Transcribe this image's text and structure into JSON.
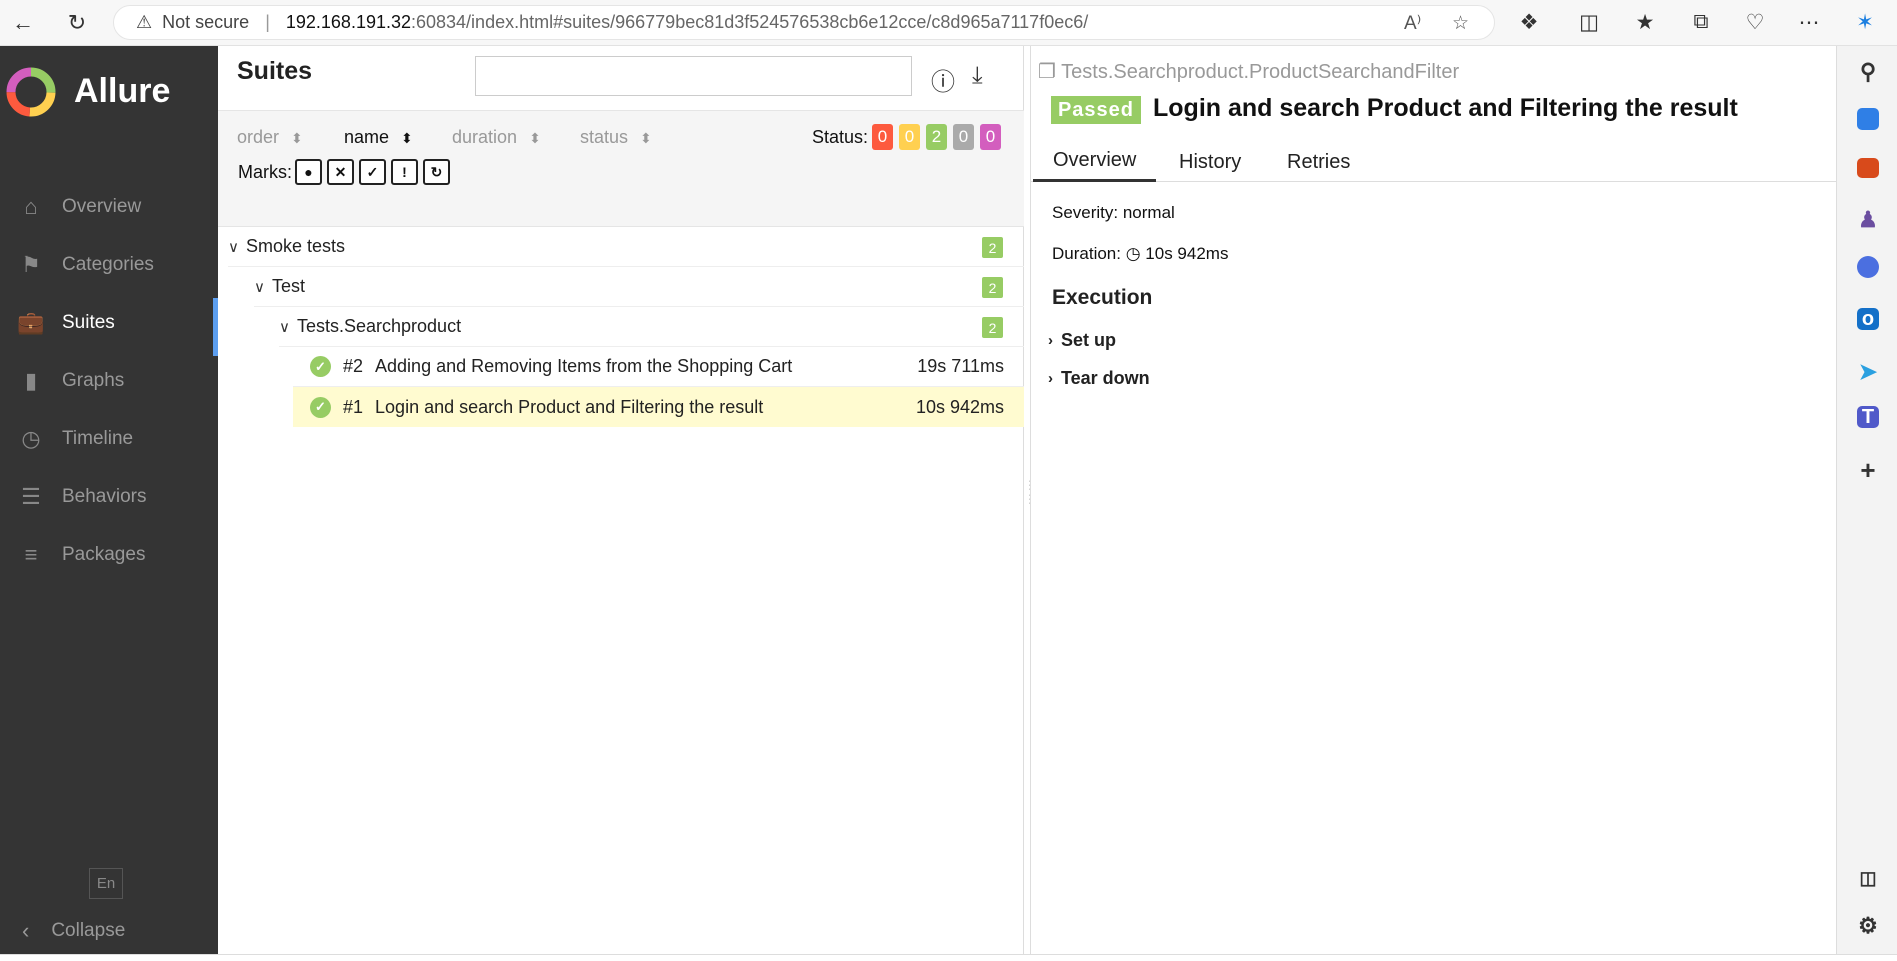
{
  "browser": {
    "security_label": "Not secure",
    "url_host": "192.168.191.32",
    "url_rest": ":60834/index.html#suites/966779bec81d3f524576538cb6e12cce/c8d965a7117f0ec6/"
  },
  "sidebar": {
    "brand": "Allure",
    "items": [
      {
        "label": "Overview",
        "icon": "home-icon"
      },
      {
        "label": "Categories",
        "icon": "flag-icon"
      },
      {
        "label": "Suites",
        "icon": "briefcase-icon"
      },
      {
        "label": "Graphs",
        "icon": "bar-chart-icon"
      },
      {
        "label": "Timeline",
        "icon": "clock-icon"
      },
      {
        "label": "Behaviors",
        "icon": "list-icon"
      },
      {
        "label": "Packages",
        "icon": "align-left-icon"
      }
    ],
    "language": "En",
    "collapse_label": "Collapse"
  },
  "suites": {
    "title": "Suites",
    "search_value": "",
    "sort": {
      "order": "order",
      "name": "name",
      "duration": "duration",
      "status": "status"
    },
    "status_label": "Status:",
    "status_counts": [
      {
        "value": "0",
        "color": "#fd5a3e"
      },
      {
        "value": "0",
        "color": "#ffd050"
      },
      {
        "value": "2",
        "color": "#97cc64"
      },
      {
        "value": "0",
        "color": "#aaaaaa"
      },
      {
        "value": "0",
        "color": "#d35ebe"
      }
    ],
    "marks_label": "Marks:",
    "tree": {
      "root": {
        "label": "Smoke tests",
        "count": "2"
      },
      "child": {
        "label": "Test",
        "count": "2"
      },
      "grandchild": {
        "label": "Tests.Searchproduct",
        "count": "2"
      },
      "tests": [
        {
          "num": "#2",
          "name": "Adding and Removing Items from the Shopping Cart",
          "duration": "19s 711ms"
        },
        {
          "num": "#1",
          "name": "Login and search Product and Filtering the result",
          "duration": "10s 942ms"
        }
      ]
    }
  },
  "details": {
    "breadcrumb": "Tests.Searchproduct.ProductSearchandFilter",
    "status": "Passed",
    "title": "Login and search Product and Filtering the result",
    "tabs": [
      "Overview",
      "History",
      "Retries"
    ],
    "severity": "Severity: normal",
    "duration_label": "Duration:",
    "duration_value": "10s 942ms",
    "execution_heading": "Execution",
    "setup_label": "Set up",
    "teardown_label": "Tear down"
  }
}
